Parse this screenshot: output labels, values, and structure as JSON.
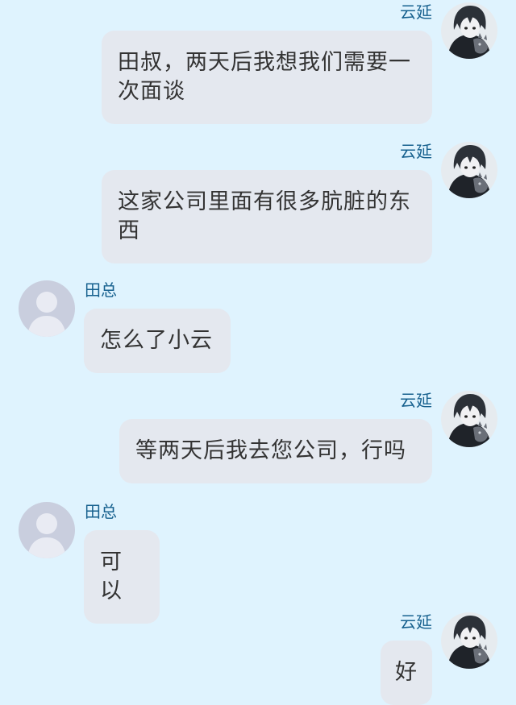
{
  "participants": {
    "self": {
      "name": "云延",
      "avatar_icon": "anime-character-avatar-icon"
    },
    "other": {
      "name": "田总",
      "avatar_icon": "default-person-avatar-icon"
    }
  },
  "colors": {
    "background": "#dff3fe",
    "bubble": "#e4e8ef",
    "name_text": "#16608e",
    "message_text": "#333333"
  },
  "messages": [
    {
      "side": "self",
      "sender": "云延",
      "text": "田叔，两天后我想我们需要一次面谈"
    },
    {
      "side": "self",
      "sender": "云延",
      "text": "这家公司里面有很多肮脏的东西"
    },
    {
      "side": "other",
      "sender": "田总",
      "text": "怎么了小云"
    },
    {
      "side": "self",
      "sender": "云延",
      "text": "等两天后我去您公司，行吗"
    },
    {
      "side": "other",
      "sender": "田总",
      "text": "可以"
    },
    {
      "side": "self",
      "sender": "云延",
      "text": "好"
    }
  ]
}
